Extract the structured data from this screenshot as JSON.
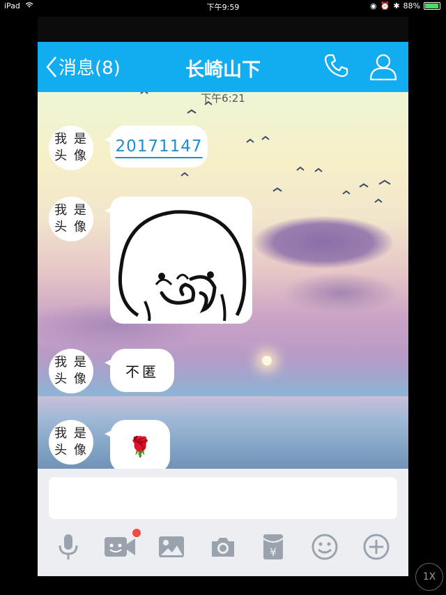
{
  "status_bar": {
    "device": "iPad",
    "time": "下午9:59",
    "battery": "88%"
  },
  "header": {
    "back_label": "消息(8)",
    "title": "长崎山下"
  },
  "chat": {
    "timestamp": "下午6:21",
    "avatar_text_line1": "我 是",
    "avatar_text_line2": "头 像",
    "messages": [
      {
        "type": "link",
        "text": "20171147"
      },
      {
        "type": "sticker",
        "sticker": "cartoon-face-sticker"
      },
      {
        "type": "text",
        "text": "不匿"
      },
      {
        "type": "emoji",
        "emoji": "🌹"
      }
    ]
  },
  "input": {
    "placeholder": ""
  },
  "toolbar": {
    "icons": [
      "microphone-icon",
      "video-call-icon",
      "image-icon",
      "camera-icon",
      "red-packet-icon",
      "emoji-icon",
      "plus-icon"
    ],
    "red_packet_symbol": "¥"
  },
  "zoom_label": "1X",
  "colors": {
    "header": "#12adf0",
    "link": "#1b8fd0",
    "badge": "#f34a42"
  }
}
